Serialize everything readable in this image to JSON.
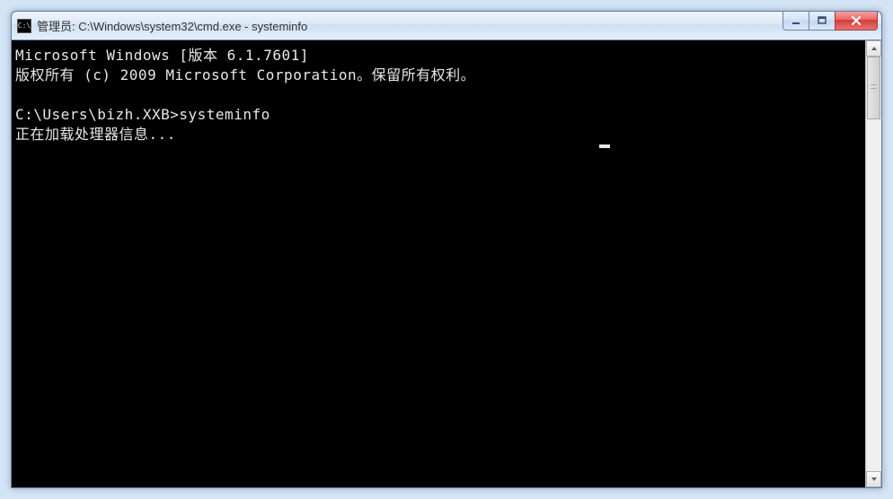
{
  "window": {
    "icon_text": "C:\\",
    "title": "管理员: C:\\Windows\\system32\\cmd.exe - systeminfo"
  },
  "terminal": {
    "line1": "Microsoft Windows [版本 6.1.7601]",
    "line2": "版权所有 (c) 2009 Microsoft Corporation。保留所有权利。",
    "blank": "",
    "prompt": "C:\\Users\\bizh.XXB>systeminfo",
    "status": "正在加载处理器信息..."
  }
}
